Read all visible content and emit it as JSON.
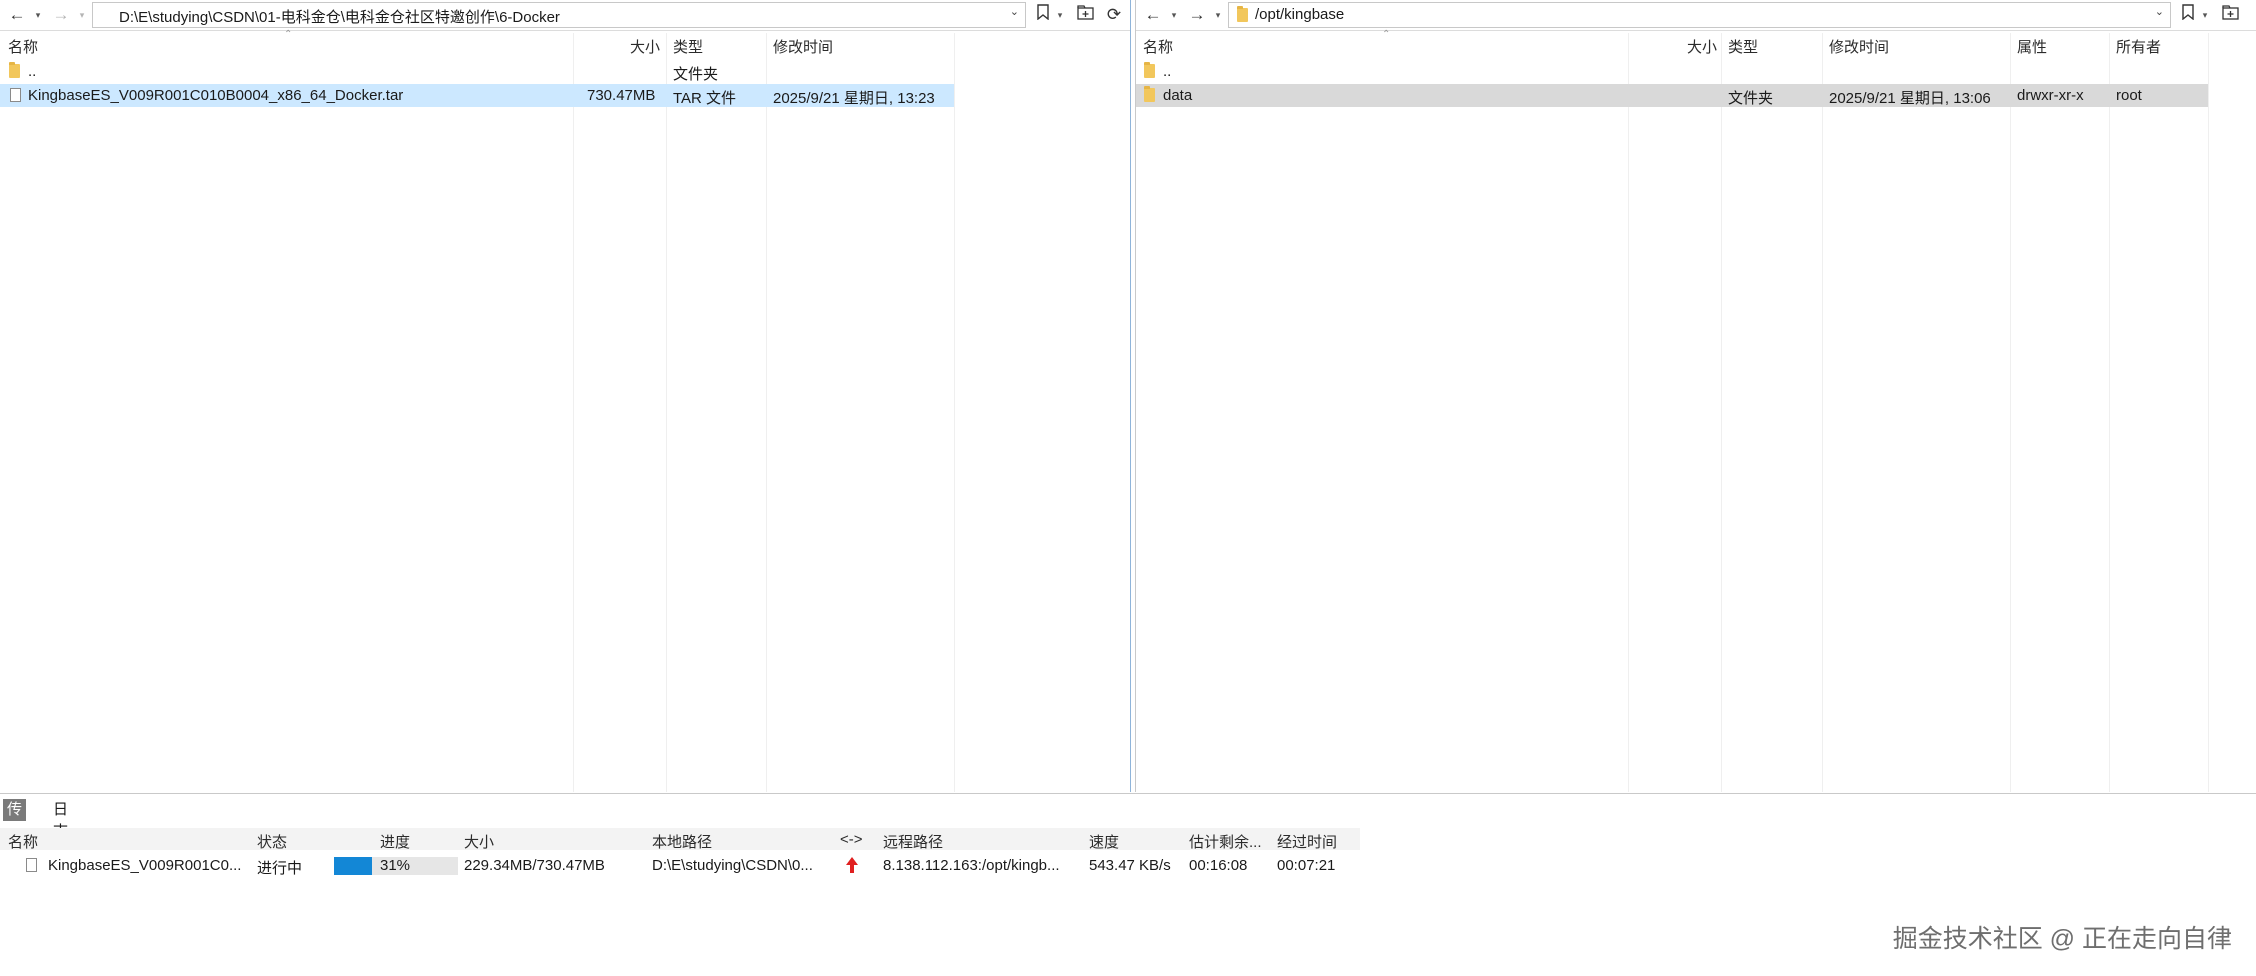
{
  "colors": {
    "selection_blue": "#cce8ff",
    "selection_gray": "#d9d9d9",
    "progress_fill": "#1387d6",
    "upload_arrow": "#e02020",
    "folder_icon": "#f2c75c"
  },
  "left_pane": {
    "path": "D:\\E\\studying\\CSDN\\01-电科金仓\\电科金仓社区特邀创作\\6-Docker",
    "toolbar_icons": [
      "back-arrow-icon",
      "forward-arrow-icon",
      "bookmark-icon",
      "new-folder-icon",
      "refresh-icon"
    ],
    "columns": {
      "name": "名称",
      "size": "大小",
      "type": "类型",
      "modified": "修改时间"
    },
    "rows": [
      {
        "name": "..",
        "size": "",
        "type": "文件夹",
        "modified": "",
        "icon": "folder-icon"
      },
      {
        "name": "KingbaseES_V009R001C010B0004_x86_64_Docker.tar",
        "size": "730.47MB",
        "type": "TAR 文件",
        "modified": "2025/9/21 星期日, 13:23",
        "icon": "file-icon",
        "selected": true
      }
    ]
  },
  "right_pane": {
    "path": "/opt/kingbase",
    "toolbar_icons": [
      "back-arrow-icon",
      "forward-arrow-icon",
      "bookmark-icon",
      "new-folder-icon"
    ],
    "columns": {
      "name": "名称",
      "size": "大小",
      "type": "类型",
      "modified": "修改时间",
      "attributes": "属性",
      "owner": "所有者"
    },
    "rows": [
      {
        "name": "..",
        "size": "",
        "type": "",
        "modified": "",
        "attributes": "",
        "owner": "",
        "icon": "folder-icon"
      },
      {
        "name": "data",
        "size": "",
        "type": "文件夹",
        "modified": "2025/9/21 星期日, 13:06",
        "attributes": "drwxr-xr-x",
        "owner": "root",
        "icon": "folder-icon",
        "selected": true
      }
    ]
  },
  "bottom": {
    "tabs": [
      {
        "label": "传输",
        "active": true
      },
      {
        "label": "日志",
        "active": false
      }
    ],
    "columns": {
      "name": "名称",
      "status": "状态",
      "progress": "进度",
      "size": "大小",
      "local_path": "本地路径",
      "direction": "<->",
      "remote_path": "远程路径",
      "speed": "速度",
      "eta": "估计剩余...",
      "elapsed": "经过时间"
    },
    "transfer": {
      "name": "KingbaseES_V009R001C0...",
      "status": "进行中",
      "progress_fraction": 0.31,
      "progress_text": "31%",
      "size": "229.34MB/730.47MB",
      "local_path": "D:\\E\\studying\\CSDN\\0...",
      "direction_icon": "upload-arrow-icon",
      "remote_path": "8.138.112.163:/opt/kingb...",
      "speed": "543.47 KB/s",
      "eta": "00:16:08",
      "elapsed": "00:07:21"
    }
  },
  "watermark": "掘金技术社区 @ 正在走向自律"
}
